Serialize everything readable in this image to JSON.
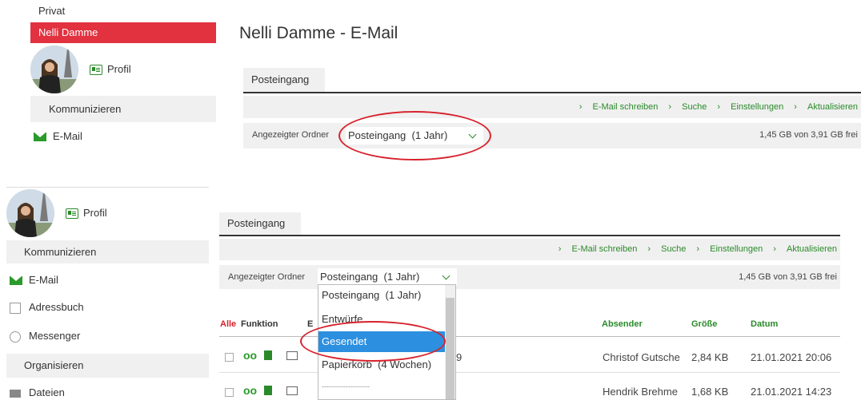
{
  "top": {
    "privat": "Privat",
    "active_user": "Nelli Damme",
    "profil": "Profil",
    "kommunizieren": "Kommunizieren",
    "email": "E-Mail",
    "page_title": "Nelli Damme - E-Mail",
    "tab": "Posteingang",
    "actions": [
      "E-Mail schreiben",
      "Suche",
      "Einstellungen",
      "Aktualisieren"
    ],
    "folder_label": "Angezeigter Ordner",
    "folder_value": "Posteingang  (1 Jahr)",
    "storage": "1,45 GB von 3,91 GB frei"
  },
  "bottom": {
    "profil": "Profil",
    "kommunizieren": "Kommunizieren",
    "nav": [
      "E-Mail",
      "Adressbuch",
      "Messenger"
    ],
    "organisieren": "Organisieren",
    "dateien": "Dateien",
    "tab": "Posteingang",
    "actions": [
      "E-Mail schreiben",
      "Suche",
      "Einstellungen",
      "Aktualisieren"
    ],
    "folder_label": "Angezeigter Ordner",
    "folder_value": "Posteingang  (1 Jahr)",
    "storage": "1,45 GB von 3,91 GB frei",
    "dropdown_options": [
      "Posteingang  (1 Jahr)",
      "Entwürfe",
      "Gesendet",
      "Papierkorb  (4 Wochen)",
      "--------------------"
    ],
    "table_headers": {
      "alle": "Alle",
      "funktion": "Funktion",
      "betreff_partial": "E",
      "absender": "Absender",
      "groesse": "Größe",
      "datum": "Datum"
    },
    "rows": [
      {
        "partial": "9",
        "absender": "Christof Gutsche",
        "groesse": "2,84 KB",
        "datum": "21.01.2021 20:06"
      },
      {
        "partial": "",
        "absender": "Hendrik Brehme",
        "groesse": "1,68 KB",
        "datum": "21.01.2021 14:23"
      }
    ]
  },
  "colors": {
    "accent_red": "#e2313f",
    "link_green": "#2a8a2a",
    "highlight_blue": "#2c8fdf",
    "annotation_red": "#d7222c"
  }
}
